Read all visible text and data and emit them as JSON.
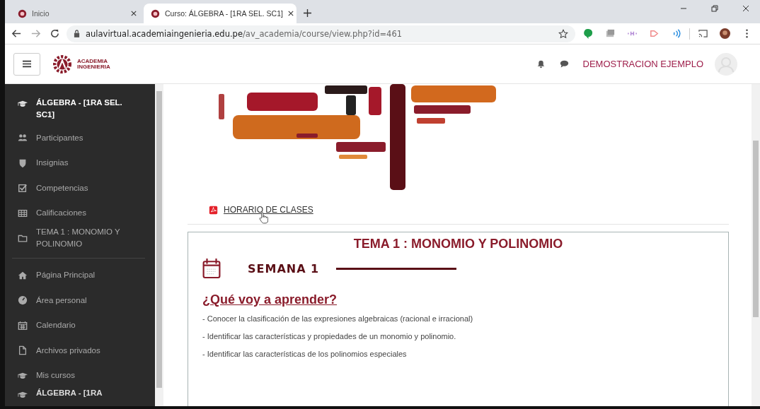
{
  "browser": {
    "tabs": [
      {
        "title": "Inicio",
        "selected": false
      },
      {
        "title": "Curso: ÁLGEBRA - [1RA SEL. SC1]",
        "selected": true
      }
    ],
    "url_host": "aulavirtual.academiaingenieria.edu.pe",
    "url_path": "/av_academia/course/view.php?id=461"
  },
  "header": {
    "logo_line_1": "ACADEMIA",
    "logo_line_2": "INGENIERIA",
    "user_name": "DEMOSTRACION EJEMPLO"
  },
  "sidebar": {
    "course": "ÁLGEBRA - [1RA SEL. SC1]",
    "items": [
      {
        "label": "Participantes",
        "kind": "users"
      },
      {
        "label": "Insignias",
        "kind": "shield"
      },
      {
        "label": "Competencias",
        "kind": "check"
      },
      {
        "label": "Calificaciones",
        "kind": "table"
      },
      {
        "label": "TEMA 1 : MONOMIO Y POLINOMIO",
        "kind": "folder"
      }
    ],
    "nav": [
      {
        "label": "Página Principal",
        "kind": "home"
      },
      {
        "label": "Área personal",
        "kind": "gauge"
      },
      {
        "label": "Calendario",
        "kind": "calendar"
      },
      {
        "label": "Archivos privados",
        "kind": "file"
      },
      {
        "label": "Mis cursos",
        "kind": "cap"
      }
    ],
    "sub_course": "ÁLGEBRA - [1RA"
  },
  "content": {
    "resource_link": "HORARIO DE CLASES",
    "section_title": "TEMA 1 : MONOMIO Y POLINOMIO",
    "week": "SEMANA 1",
    "heading": "¿Qué voy a aprender?",
    "goals": [
      "- Conocer la clasificación de las expresiones algebraicas (racional e irracional)",
      "- Identificar las características y propiedades de un monomio y polinomio.",
      "- Identificar las características de los polinomios especiales"
    ]
  }
}
